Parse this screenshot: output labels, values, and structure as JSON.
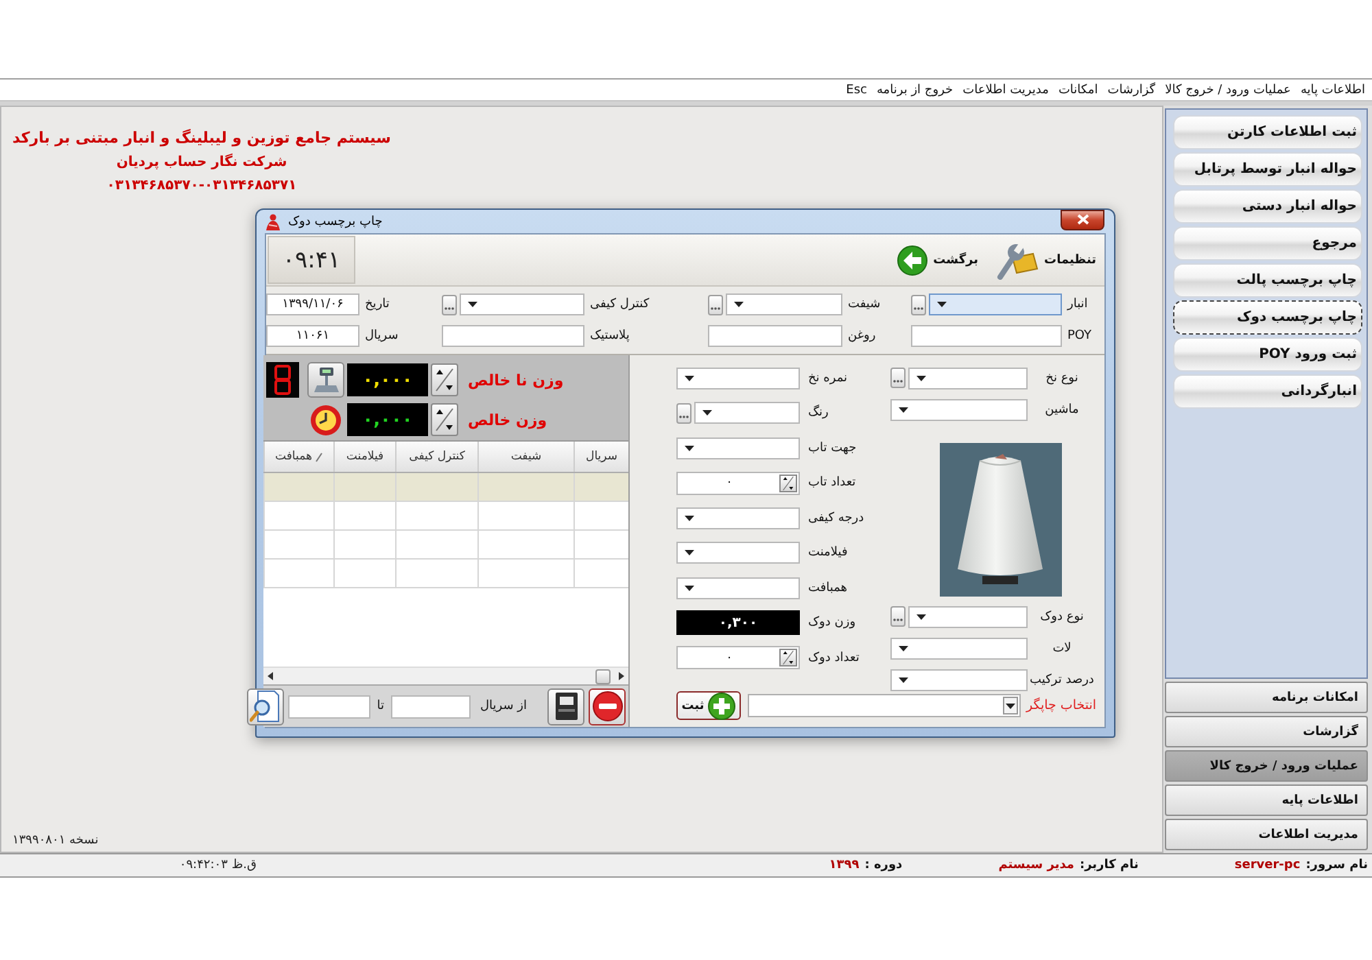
{
  "menu_bar": {
    "items": [
      "اطلاعات پایه",
      "عملیات ورود / خروج کالا",
      "گزارشات",
      "امکانات",
      "مدیریت اطلاعات",
      "خروج از برنامه",
      "Esc"
    ]
  },
  "header": {
    "title": "سیستم جامع توزین و لیبلینگ و انبار مبتنی بر بارکد",
    "company": "شرکت نگار حساب پردیان",
    "phone": "۰۳۱۳۴۶۸۵۳۷۰-۰۳۱۳۴۶۸۵۳۷۱"
  },
  "version": "نسخه ۱۳۹۹۰۸۰۱",
  "dialog": {
    "title": "چاپ برچسب دوک",
    "clock": "۰۹:۴۱",
    "toolbar": [
      {
        "kind": "settings",
        "label": "تنظیمات"
      },
      {
        "kind": "back",
        "label": "برگشت"
      }
    ],
    "header_fields": [
      {
        "kind": "combo",
        "label": "انبار",
        "lookup": true,
        "focused": true
      },
      {
        "kind": "combo",
        "label": "شیفت",
        "lookup": true,
        "focused": false
      },
      {
        "kind": "combo",
        "label": "کنترل کیفی",
        "lookup": true,
        "focused": false
      },
      {
        "kind": "text",
        "label": "تاریخ",
        "value": "۱۳۹۹/۱۱/۰۶"
      },
      {
        "kind": "text",
        "label": "POY"
      },
      {
        "kind": "text",
        "label": "روغن"
      },
      {
        "kind": "text",
        "label": "پلاستیک"
      },
      {
        "kind": "text",
        "label": "سریال",
        "value": "۱۱۰۶۱"
      }
    ],
    "scale": [
      {
        "kind": "gross",
        "label": "وزن نا خالص",
        "reading": "۰,۰۰۰"
      },
      {
        "kind": "net",
        "label": "وزن خالص",
        "reading": "۰,۰۰۰"
      }
    ],
    "table": {
      "columns": [
        {
          "label": "سریال",
          "sorted": false
        },
        {
          "label": "شیفت",
          "sorted": false
        },
        {
          "label": "کنترل کیفی",
          "sorted": false
        },
        {
          "label": "فیلامنت",
          "sorted": false
        },
        {
          "label": "همبافت",
          "sorted": true
        }
      ],
      "rows": [
        {
          "selected": true
        },
        {
          "selected": false
        },
        {
          "selected": false
        },
        {
          "selected": false
        }
      ]
    },
    "range": {
      "from_label": "از سریال",
      "to_label": "تا"
    },
    "form": {
      "side": [
        {
          "kind": "combo",
          "label": "نوع نخ",
          "lookup": true
        },
        {
          "kind": "combo",
          "label": "ماشین",
          "lookup": false
        },
        {
          "kind": "photo"
        },
        {
          "kind": "combo",
          "label": "نوع دوک",
          "lookup": true
        },
        {
          "kind": "combo",
          "label": "لات",
          "lookup": false
        },
        {
          "kind": "combo",
          "label": "درصد ترکیب",
          "lookup": false
        }
      ],
      "main": [
        {
          "kind": "combo",
          "label": "نمره نخ",
          "lookup": false
        },
        {
          "kind": "combo",
          "label": "رنگ",
          "lookup": true
        },
        {
          "kind": "combo",
          "label": "جهت تاب",
          "lookup": false
        },
        {
          "kind": "spin",
          "label": "تعداد تاب",
          "value": "۰"
        },
        {
          "kind": "combo",
          "label": "درجه کیفی",
          "lookup": false
        },
        {
          "kind": "combo",
          "label": "فیلامنت",
          "lookup": false
        },
        {
          "kind": "combo",
          "label": "همبافت",
          "lookup": false
        },
        {
          "kind": "display",
          "label": "وزن دوک",
          "value": "۰,۳۰۰"
        },
        {
          "kind": "spin",
          "label": "تعداد دوک",
          "value": "۰"
        }
      ]
    },
    "printer": {
      "label": "انتخاب چاپگر",
      "button": "ثبت"
    }
  },
  "sidebar": {
    "items": [
      {
        "label": "ثبت اطلاعات کارتن",
        "selected": false
      },
      {
        "label": "حواله انبار توسط پرتابل",
        "selected": false
      },
      {
        "label": "حواله انبار دستی",
        "selected": false
      },
      {
        "label": "مرجوع",
        "selected": false
      },
      {
        "label": "چاپ برچسب پالت",
        "selected": false
      },
      {
        "label": "چاپ برچسب دوک",
        "selected": true
      },
      {
        "label": "ثبت ورود POY",
        "selected": false
      },
      {
        "label": "انبارگردانی",
        "selected": false
      }
    ],
    "sections": [
      {
        "label": "امکانات برنامه",
        "selected": false
      },
      {
        "label": "گزارشات",
        "selected": false
      },
      {
        "label": "عملیات ورود / خروج کالا",
        "selected": true
      },
      {
        "label": "اطلاعات پایه",
        "selected": false
      },
      {
        "label": "مدیریت اطلاعات",
        "selected": false
      }
    ]
  },
  "status_bar": {
    "fields": [
      {
        "label": "نام سرور:",
        "value": "server-pc"
      },
      {
        "label": "نام کاربر:",
        "value": "مدیر سیستم"
      },
      {
        "label": "دوره :",
        "value": "۱۳۹۹"
      }
    ],
    "time": "۰۹:۴۲:۰۳ ق.ظ"
  }
}
